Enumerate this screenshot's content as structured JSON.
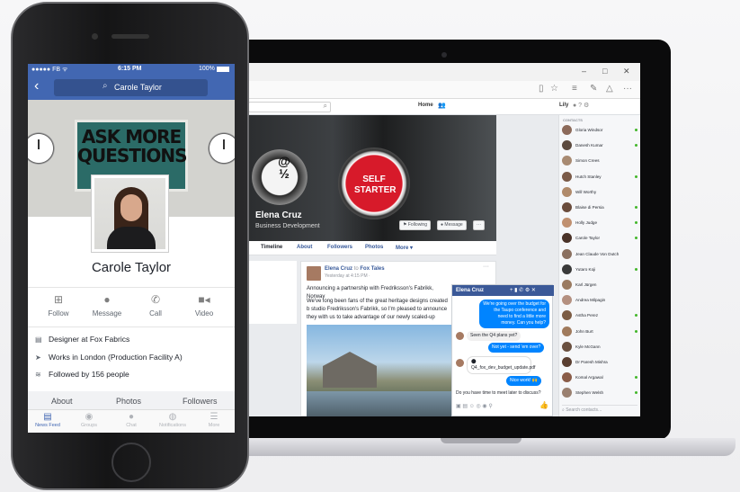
{
  "desktop": {
    "window_controls": [
      "–",
      "□",
      "✕"
    ],
    "nav": {
      "home_label": "Home",
      "user_label": "Lily"
    },
    "cover": {
      "key1_glyph": "@\n½",
      "key2_text": "SELF STARTER",
      "name": "Elena Cruz",
      "role": "Business Development",
      "following_label": "Following",
      "message_label": "Message",
      "more_label": "···"
    },
    "tabs": [
      "Timeline",
      "About",
      "Followers",
      "Photos",
      "More ▾"
    ],
    "post": {
      "author": "Elena Cruz",
      "connector": "to",
      "group": "Fox Tales",
      "time": "Yesterday at 4:15 PM · ",
      "line1": "Announcing a partnership with Fredriksson's Fabrikk, Norway",
      "line2": "We've long been fans of the great heritage designs created b studio Fredriksson's Fabrikk, so I'm pleased to announce they with us to take advantage of our newly scaled-up manufactu"
    },
    "chat": {
      "title": "Elena Cruz",
      "messages": [
        {
          "dir": "out",
          "text": "We're going over the budget for the Taupo conference and need to find a little more money. Can you help?"
        },
        {
          "dir": "in",
          "text": "Seen the Q4 plans yet?"
        },
        {
          "dir": "out",
          "text": "Not yet - send 'em over?"
        },
        {
          "dir": "in",
          "text": "Q4_fox_dev_budget_update.pdf"
        },
        {
          "dir": "out",
          "text": "Nice work! 🙌"
        }
      ],
      "input_text": "Do you have time to meet later to discuss?"
    },
    "contacts": {
      "label": "CONTACTS",
      "search_placeholder": "Search contacts...",
      "list": [
        {
          "name": "Gloria Windsor",
          "online": true,
          "color": "#8c6a5a"
        },
        {
          "name": "Danesh Kumar",
          "online": true,
          "color": "#5c4a3e"
        },
        {
          "name": "Simon Crees",
          "online": false,
          "color": "#a88a72"
        },
        {
          "name": "Hutch Stanley",
          "online": true,
          "color": "#7a5a48"
        },
        {
          "name": "Will Worthy",
          "online": false,
          "color": "#b08a6a"
        },
        {
          "name": "Blaise di Persia",
          "online": true,
          "color": "#6a4c3c"
        },
        {
          "name": "Holly Judge",
          "online": true,
          "color": "#c09070"
        },
        {
          "name": "Carole Taylor",
          "online": true,
          "color": "#4a3228"
        },
        {
          "name": "Jean Claude Von Dutch",
          "online": false,
          "color": "#8a7060"
        },
        {
          "name": "Yutaro Koji",
          "online": true,
          "color": "#3a3a3a"
        },
        {
          "name": "Karl Jürgen",
          "online": false,
          "color": "#9a7a60"
        },
        {
          "name": "Andrea Milpagin",
          "online": false,
          "color": "#b49080"
        },
        {
          "name": "Astha Perez",
          "online": true,
          "color": "#7c5c44"
        },
        {
          "name": "John Burt",
          "online": true,
          "color": "#a07a5c"
        },
        {
          "name": "Kyle McGann",
          "online": false,
          "color": "#6a5040"
        },
        {
          "name": "Dr Paresh Mishra",
          "online": false,
          "color": "#5a3e30"
        },
        {
          "name": "Komal Argawal",
          "online": true,
          "color": "#8a5c48"
        },
        {
          "name": "Stephen Welsh",
          "online": true,
          "color": "#9a8070"
        }
      ]
    }
  },
  "phone": {
    "status": {
      "carrier": "●●●●● FB ᯤ",
      "time": "6:15 PM",
      "battery": "100%",
      "battery_level": 1.0
    },
    "back_icon": "‹",
    "search_text": "Carole Taylor",
    "poster_text": "ASK MORE\nQUESTIONS",
    "name": "Carole Taylor",
    "actions": [
      {
        "label": "Follow",
        "icon": "follow-icon"
      },
      {
        "label": "Message",
        "icon": "message-icon"
      },
      {
        "label": "Call",
        "icon": "call-icon"
      },
      {
        "label": "Video",
        "icon": "video-icon"
      }
    ],
    "details": [
      {
        "icon": "briefcase-icon",
        "text": "Designer at Fox Fabrics"
      },
      {
        "icon": "location-icon",
        "text": "Works in London (Production Facility A)"
      },
      {
        "icon": "rss-icon",
        "text": "Followed by 156 people"
      }
    ],
    "tabs": [
      "About",
      "Photos",
      "Followers"
    ],
    "tabbar": [
      {
        "label": "News Feed",
        "active": true
      },
      {
        "label": "Groups",
        "active": false
      },
      {
        "label": "Chat",
        "active": false
      },
      {
        "label": "Notifications",
        "active": false
      },
      {
        "label": "More",
        "active": false
      }
    ],
    "accent_color": "#4267b2"
  }
}
